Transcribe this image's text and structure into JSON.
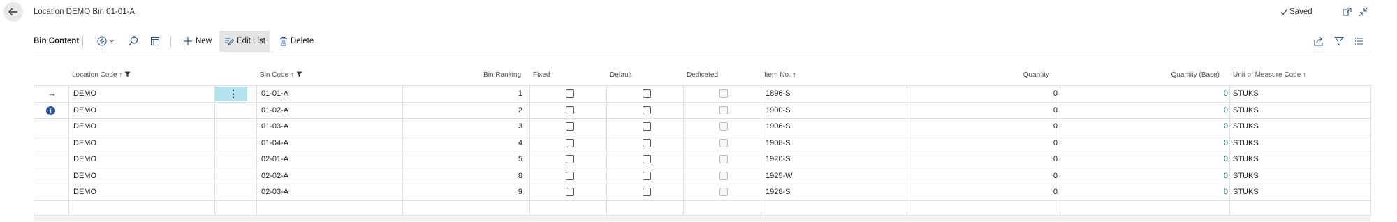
{
  "page": {
    "title": "Location DEMO Bin 01-01-A",
    "saved": "Saved"
  },
  "actionbar": {
    "title": "Bin Content",
    "new": "New",
    "edit_list": "Edit List",
    "delete": "Delete"
  },
  "columns": {
    "location_code": "Location Code",
    "bin_code": "Bin Code",
    "bin_ranking": "Bin Ranking",
    "fixed": "Fixed",
    "default": "Default",
    "dedicated": "Dedicated",
    "item_no": "Item No.",
    "quantity": "Quantity",
    "quantity_base": "Quantity (Base)",
    "uom_code": "Unit of Measure Code"
  },
  "rows": [
    {
      "location": "DEMO",
      "bin": "01-01-A",
      "ranking": "1",
      "item": "1896-S",
      "qty": "0",
      "qty_base": "0",
      "uom": "STUKS"
    },
    {
      "location": "DEMO",
      "bin": "01-02-A",
      "ranking": "2",
      "item": "1900-S",
      "qty": "0",
      "qty_base": "0",
      "uom": "STUKS"
    },
    {
      "location": "DEMO",
      "bin": "01-03-A",
      "ranking": "3",
      "item": "1906-S",
      "qty": "0",
      "qty_base": "0",
      "uom": "STUKS"
    },
    {
      "location": "DEMO",
      "bin": "01-04-A",
      "ranking": "4",
      "item": "1908-S",
      "qty": "0",
      "qty_base": "0",
      "uom": "STUKS"
    },
    {
      "location": "DEMO",
      "bin": "02-01-A",
      "ranking": "5",
      "item": "1920-S",
      "qty": "0",
      "qty_base": "0",
      "uom": "STUKS"
    },
    {
      "location": "DEMO",
      "bin": "02-02-A",
      "ranking": "8",
      "item": "1925-W",
      "qty": "0",
      "qty_base": "0",
      "uom": "STUKS"
    },
    {
      "location": "DEMO",
      "bin": "02-03-A",
      "ranking": "9",
      "item": "1928-S",
      "qty": "0",
      "qty_base": "0",
      "uom": "STUKS"
    }
  ],
  "colors": {
    "accent": "#00796b",
    "info": "#2b579a",
    "selected_cell": "#b2e3ec"
  }
}
